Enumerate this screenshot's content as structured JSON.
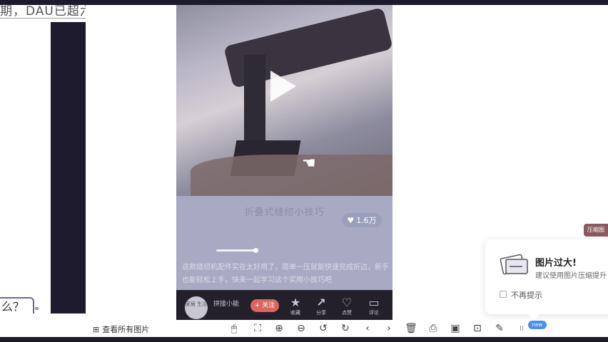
{
  "doc": {
    "top_text": "期，DAU已超六",
    "ask_text": "么？"
  },
  "video": {
    "caption": "折叠式缝纫小技巧",
    "like_count": "1.6万",
    "description": "这款缝纫机配件实在太好用了，简单一压就能快速完成折边，新手也能轻松上手，快来一起学习这个实用小技巧吧",
    "author_avatar_text": "家居\n生活",
    "author_name": "拼接小能",
    "follow_label": "+ 关注",
    "actions": [
      {
        "icon": "star-icon",
        "glyph": "★",
        "label": "收藏"
      },
      {
        "icon": "share-icon",
        "glyph": "↗",
        "label": "分享"
      },
      {
        "icon": "heart-icon",
        "glyph": "♡",
        "label": "点赞"
      },
      {
        "icon": "comment-icon",
        "glyph": "▭",
        "label": "评论"
      }
    ]
  },
  "toast": {
    "tag": "压缩图",
    "title": "图片过大!",
    "body": "建议使用图片压缩提升",
    "checkbox_label": "不再提示"
  },
  "toolbar": {
    "view_all": "查看所有图片",
    "new_badge": "new",
    "tools": [
      {
        "name": "mouse-icon",
        "glyph": "🖱"
      },
      {
        "name": "crop-icon",
        "glyph": "⛶"
      },
      {
        "name": "zoom-in-icon",
        "glyph": "⊕"
      },
      {
        "name": "zoom-out-icon",
        "glyph": "⊖"
      },
      {
        "name": "rotate-left-icon",
        "glyph": "↺"
      },
      {
        "name": "rotate-right-icon",
        "glyph": "↻"
      },
      {
        "name": "prev-icon",
        "glyph": "‹"
      },
      {
        "name": "next-icon",
        "glyph": "›"
      },
      {
        "name": "delete-icon",
        "glyph": "🗑"
      },
      {
        "name": "print-icon",
        "glyph": "⎙"
      },
      {
        "name": "image-edit-icon",
        "glyph": "▣"
      },
      {
        "name": "compress-icon",
        "glyph": "⊡"
      },
      {
        "name": "edit-icon",
        "glyph": "✎"
      },
      {
        "name": "grid-more-icon",
        "glyph": "⁝⁝"
      }
    ]
  },
  "colors": {
    "chrome_dark": "#1c1a2b",
    "follow_red": "#d9675f",
    "badge_blue": "#4a8ff0"
  }
}
